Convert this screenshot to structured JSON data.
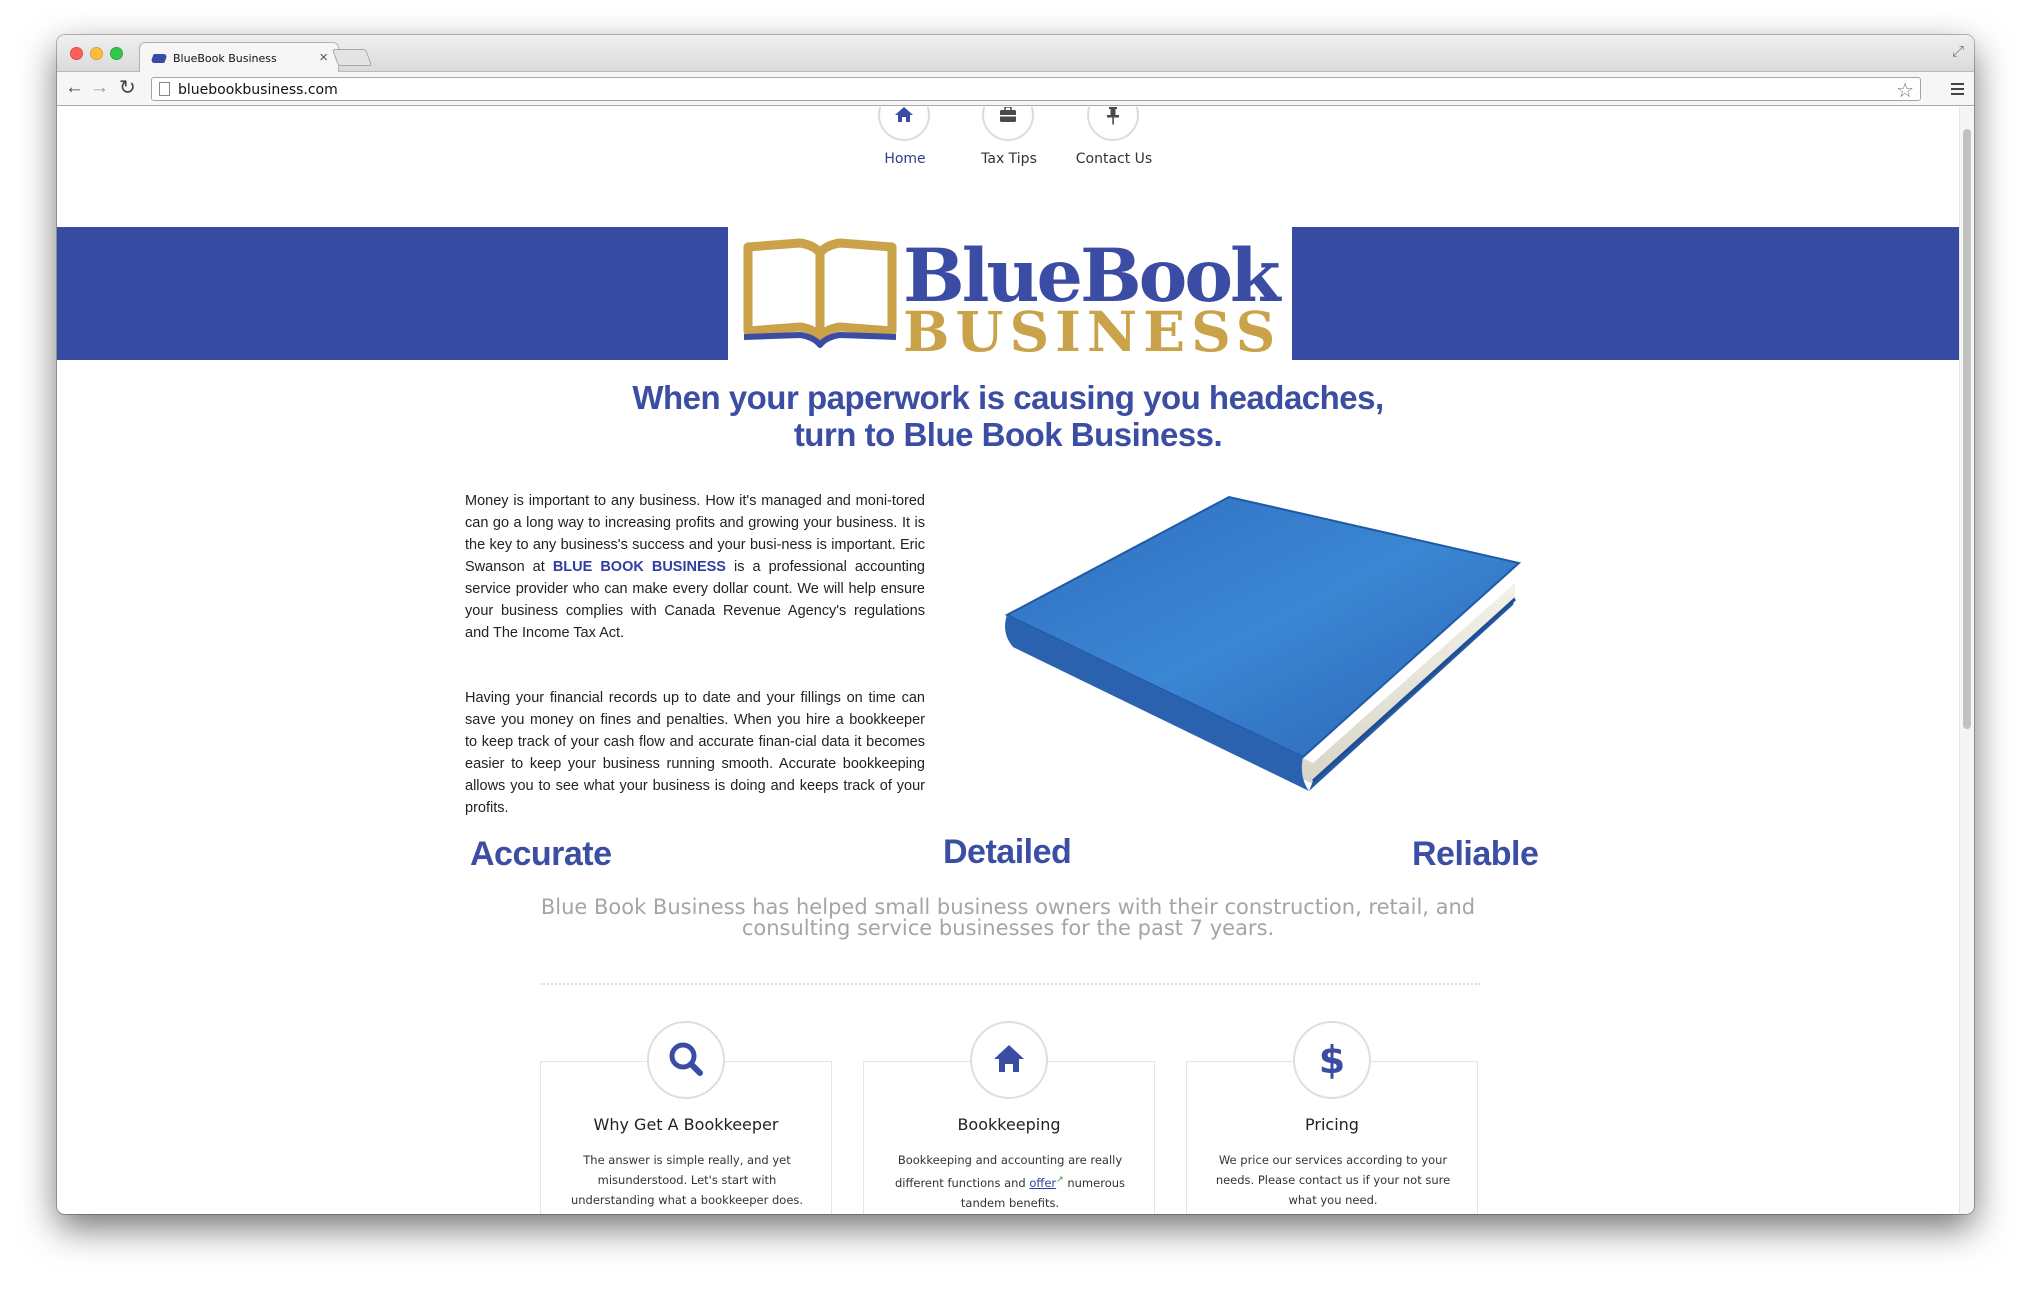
{
  "browser": {
    "tab_title": "BlueBook Business",
    "tab_close": "×",
    "url": "bluebookbusiness.com",
    "icons": [
      "back-arrow-icon",
      "forward-arrow-icon",
      "reload-icon",
      "page-icon",
      "star-icon",
      "menu-icon",
      "fullscreen-icon"
    ]
  },
  "nav": {
    "items": [
      {
        "label": "Home",
        "icon": "home-icon",
        "active": true
      },
      {
        "label": "Tax Tips",
        "icon": "briefcase-icon"
      },
      {
        "label": "Contact Us",
        "icon": "pin-icon"
      }
    ]
  },
  "logo": {
    "line1": "BlueBook",
    "line2": "BUSINESS"
  },
  "hero": {
    "headline_line1": "When your paperwork is causing you headaches,",
    "headline_line2": "turn to Blue Book Business."
  },
  "intro": {
    "p1_before": "Money is important to any business. How it's managed and moni-tored can go a long way to increasing profits and growing your business. It is the key to any business's success and your busi-ness is important. Eric Swanson at ",
    "p1_highlight": "BLUE BOOK BUSINESS",
    "p1_after": " is a professional accounting service provider who can make every dollar count. We will help ensure your business complies with Canada Revenue Agency's regulations and The Income Tax Act.",
    "p2": "Having your financial records up to date and your fillings on time can save you money on fines and penalties. When you hire a bookkeeper to keep track of your cash flow and accurate finan-cial data it becomes easier to keep your business running smooth. Accurate bookkeeping allows you to see what your business is doing and keeps track of your profits."
  },
  "values": {
    "accurate": "Accurate",
    "detailed": "Detailed",
    "reliable": "Reliable"
  },
  "tagline": {
    "line1": "Blue Book Business has helped small business owners with their construction, retail, and",
    "line2": "consulting service businesses for the past 7 years."
  },
  "cards": [
    {
      "title": "Why Get A Bookkeeper",
      "icon": "search-icon",
      "text": "The answer is simple really, and yet misunderstood. Let's start with understanding what a bookkeeper does."
    },
    {
      "title": "Bookkeeping",
      "icon": "home-icon",
      "text_before": "Bookkeeping and accounting are really different functions and ",
      "link": "offer",
      "text_after": " numerous tandem benefits."
    },
    {
      "title": "Pricing",
      "icon": "dollar-icon",
      "text": "We price our services according to your needs. Please contact us if your not sure what you need."
    }
  ],
  "colors": {
    "brand_blue": "#374ba2",
    "brand_gold": "#c9a24a",
    "tagline_gray": "#a5a5a5"
  }
}
